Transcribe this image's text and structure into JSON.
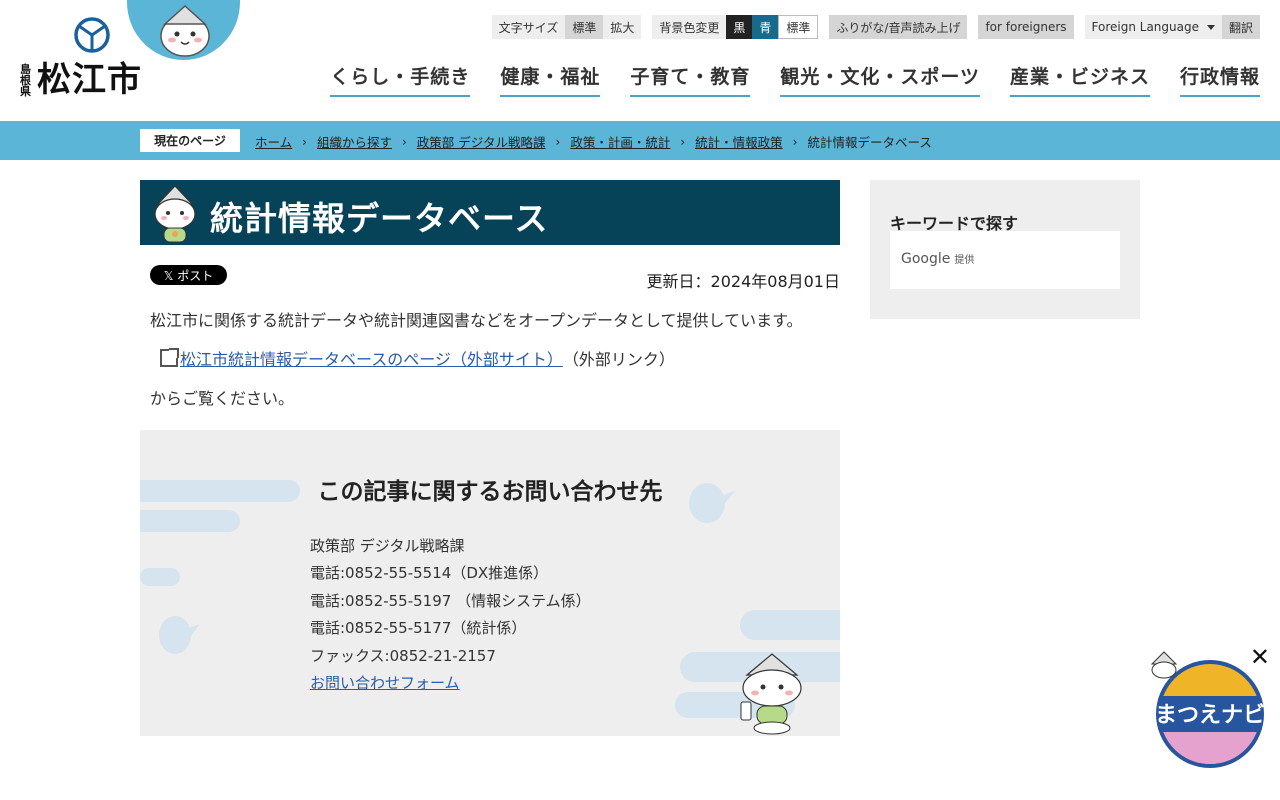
{
  "header": {
    "prefecture": "島根県",
    "city": "松江市",
    "utility": {
      "font_size_label": "文字サイズ",
      "font_standard": "標準",
      "font_large": "拡大",
      "bg_label": "背景色変更",
      "bg_black": "黒",
      "bg_blue": "青",
      "bg_standard": "標準",
      "furigana": "ふりがな/音声読み上げ",
      "foreigners": "for foreigners",
      "foreign_language": "Foreign Language",
      "translate": "翻訳"
    },
    "nav": [
      "くらし・手続き",
      "健康・福祉",
      "子育て・教育",
      "観光・文化・スポーツ",
      "産業・ビジネス",
      "行政情報"
    ]
  },
  "breadcrumb": {
    "current_label": "現在のページ",
    "items": [
      "ホーム",
      "組織から探す",
      "政策部 デジタル戦略課",
      "政策・計画・統計",
      "統計・情報政策",
      "統計情報データベース"
    ]
  },
  "main": {
    "title": "統計情報データベース",
    "post_button": "𝕏 ポスト",
    "updated": "更新日：2024年08月01日",
    "paragraph1": "松江市に関係する統計データや統計関連図書などをオープンデータとして提供しています。",
    "ext_link": "松江市統計情報データベースのページ（外部サイト）",
    "ext_note": "（外部リンク）",
    "paragraph2": "からご覧ください。",
    "contact": {
      "heading": "この記事に関するお問い合わせ先",
      "dept": "政策部 デジタル戦略課",
      "tel1": "電話:0852-55-5514（DX推進係）",
      "tel2": "電話:0852-55-5197 （情報システム係）",
      "tel3": "電話:0852-55-5177（統計係）",
      "fax": "ファックス:0852-21-2157",
      "form_link": "お問い合わせフォーム"
    }
  },
  "sidebar": {
    "search_heading": "キーワードで探す",
    "google": "Google",
    "google_provided": "提供"
  },
  "navi": {
    "label": "まつえナビ"
  },
  "colors": {
    "accent": "#5ab5d6",
    "title_bg": "#064358"
  }
}
